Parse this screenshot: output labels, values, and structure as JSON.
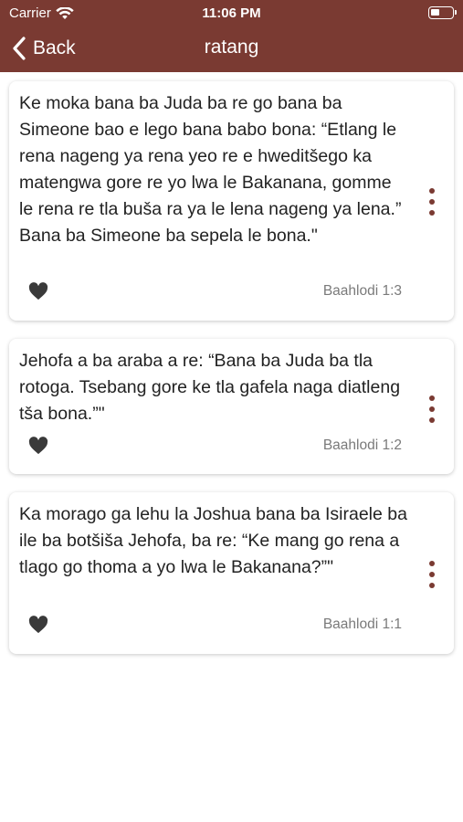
{
  "status_bar": {
    "carrier": "Carrier",
    "time": "11:06 PM"
  },
  "nav": {
    "back_label": "Back",
    "title": "ratang"
  },
  "colors": {
    "header": "#7a3a32",
    "accent": "#7a3a32",
    "text": "#222222",
    "muted": "#7a7a7a"
  },
  "cards": [
    {
      "text": "Ke moka bana ba Juda ba re go bana ba Simeone bao e lego bana babo bona: “Etlang le rena nageng ya rena yeo re e hweditšego ka matengwa gore re yo lwa le Bakanana, gomme le rena re tla buša ra ya le lena nageng ya lena.” Bana ba Simeone ba sepela le bona.\"",
      "reference": "Baahlodi 1:3",
      "favorite_icon": "heart-icon",
      "menu_icon": "more-vertical-icon"
    },
    {
      "text": "Jehofa a ba araba a re: “Bana ba Juda ba tla rotoga. Tsebang gore ke tla gafela naga diatleng tša bona.”\"",
      "reference": "Baahlodi 1:2",
      "favorite_icon": "heart-icon",
      "menu_icon": "more-vertical-icon"
    },
    {
      "text": "Ka morago ga lehu la Joshua bana ba Isiraele ba ile ba botšiša Jehofa, ba re: “Ke mang go rena a tlago go thoma a yo lwa le Bakanana?”\"",
      "reference": "Baahlodi 1:1",
      "favorite_icon": "heart-icon",
      "menu_icon": "more-vertical-icon"
    }
  ]
}
